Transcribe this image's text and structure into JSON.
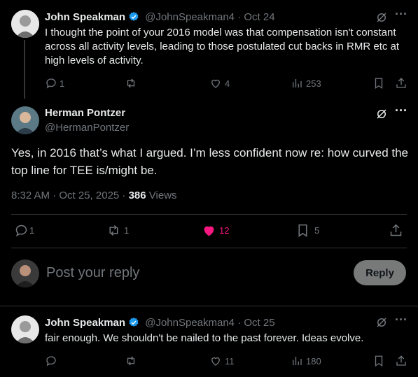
{
  "tweet1": {
    "name": "John Speakman",
    "handle": "@JohnSpeakman4",
    "sep": "·",
    "date": "Oct 24",
    "text": "I thought the point of your 2016 model was that compensation isn't constant across all activity levels, leading to those postulated cut backs in RMR etc at high levels of activity.",
    "replies": "1",
    "likes": "4",
    "views": "253"
  },
  "main": {
    "name": "Herman Pontzer",
    "handle": "@HermanPontzer",
    "text": "Yes, in 2016 that’s what I argued. I’m less confident now re: how curved the top line for TEE is/might be.",
    "time": "8:32 AM · Oct 25, 2025 · ",
    "views_count": "386",
    "views_label": " Views",
    "replies": "1",
    "retweets": "1",
    "likes": "12",
    "bookmarks": "5"
  },
  "composer": {
    "placeholder": "Post your reply",
    "reply_label": "Reply"
  },
  "tweet3": {
    "name": "John Speakman",
    "handle": "@JohnSpeakman4",
    "sep": "·",
    "date": "Oct 25",
    "text": "fair enough. We shouldn't be nailed to the past forever. Ideas evolve.",
    "likes": "11",
    "views": "180"
  },
  "colors": {
    "like_active": "#f91880",
    "verified": "#1d9bf0",
    "reply_button_bg": "#787a7a"
  }
}
